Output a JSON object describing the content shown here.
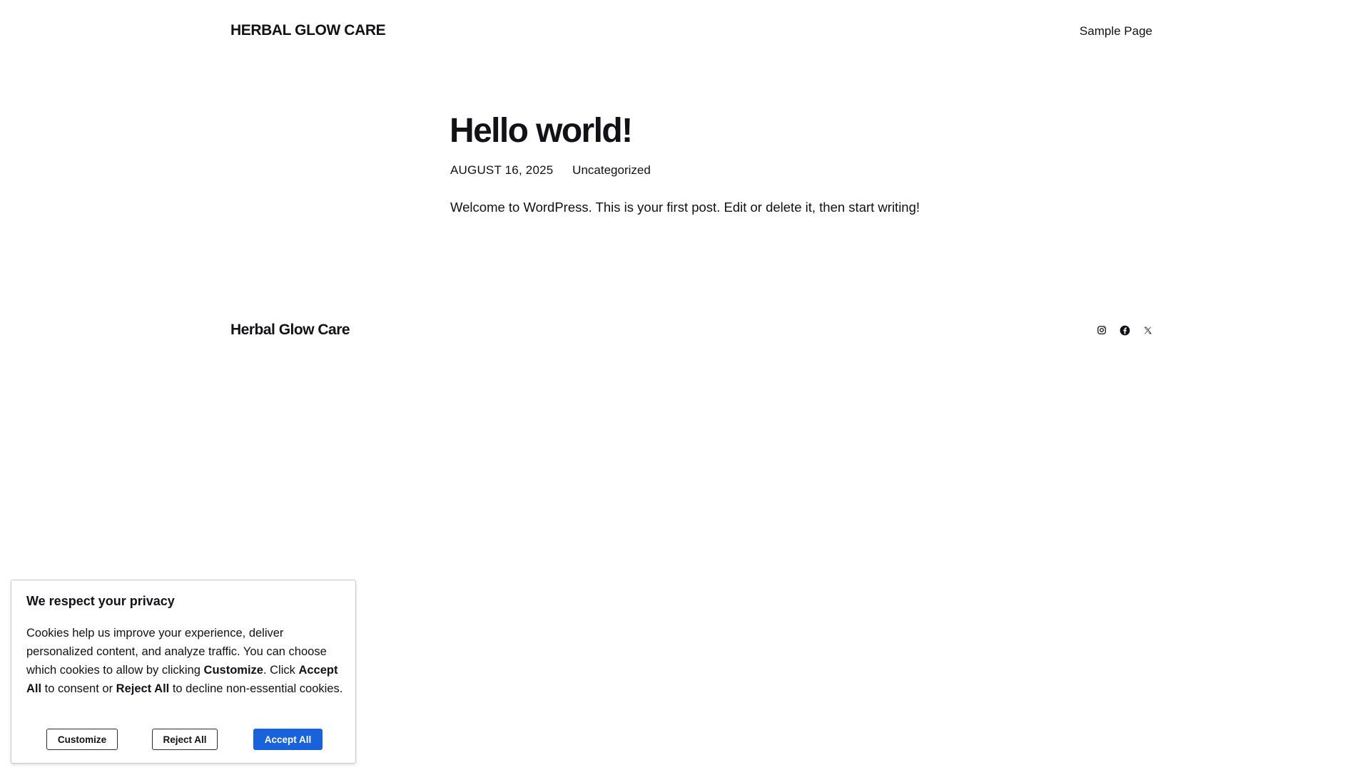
{
  "header": {
    "site_title": "HERBAL GLOW CARE",
    "nav": [
      {
        "label": "Sample Page"
      }
    ]
  },
  "post": {
    "title": "Hello world!",
    "date": "AUGUST 16, 2025",
    "category": "Uncategorized",
    "body": "Welcome to WordPress. This is your first post. Edit or delete it, then start writing!"
  },
  "footer": {
    "site_title": "Herbal Glow Care",
    "social": [
      {
        "icon": "instagram-icon"
      },
      {
        "icon": "facebook-icon"
      },
      {
        "icon": "x-icon"
      }
    ]
  },
  "cookie_banner": {
    "title": "We respect your privacy",
    "text_part1": "Cookies help us improve your experience, deliver personalized content, and analyze traffic. You can choose which cookies to allow by clicking ",
    "text_customize": "Customize",
    "text_part2": ". Click ",
    "text_accept": "Accept All",
    "text_part3": " to consent or ",
    "text_reject": "Reject All",
    "text_part4": " to decline non-essential cookies.",
    "buttons": {
      "customize": "Customize",
      "reject": "Reject All",
      "accept": "Accept All"
    },
    "accent_color": "#1863dc"
  }
}
